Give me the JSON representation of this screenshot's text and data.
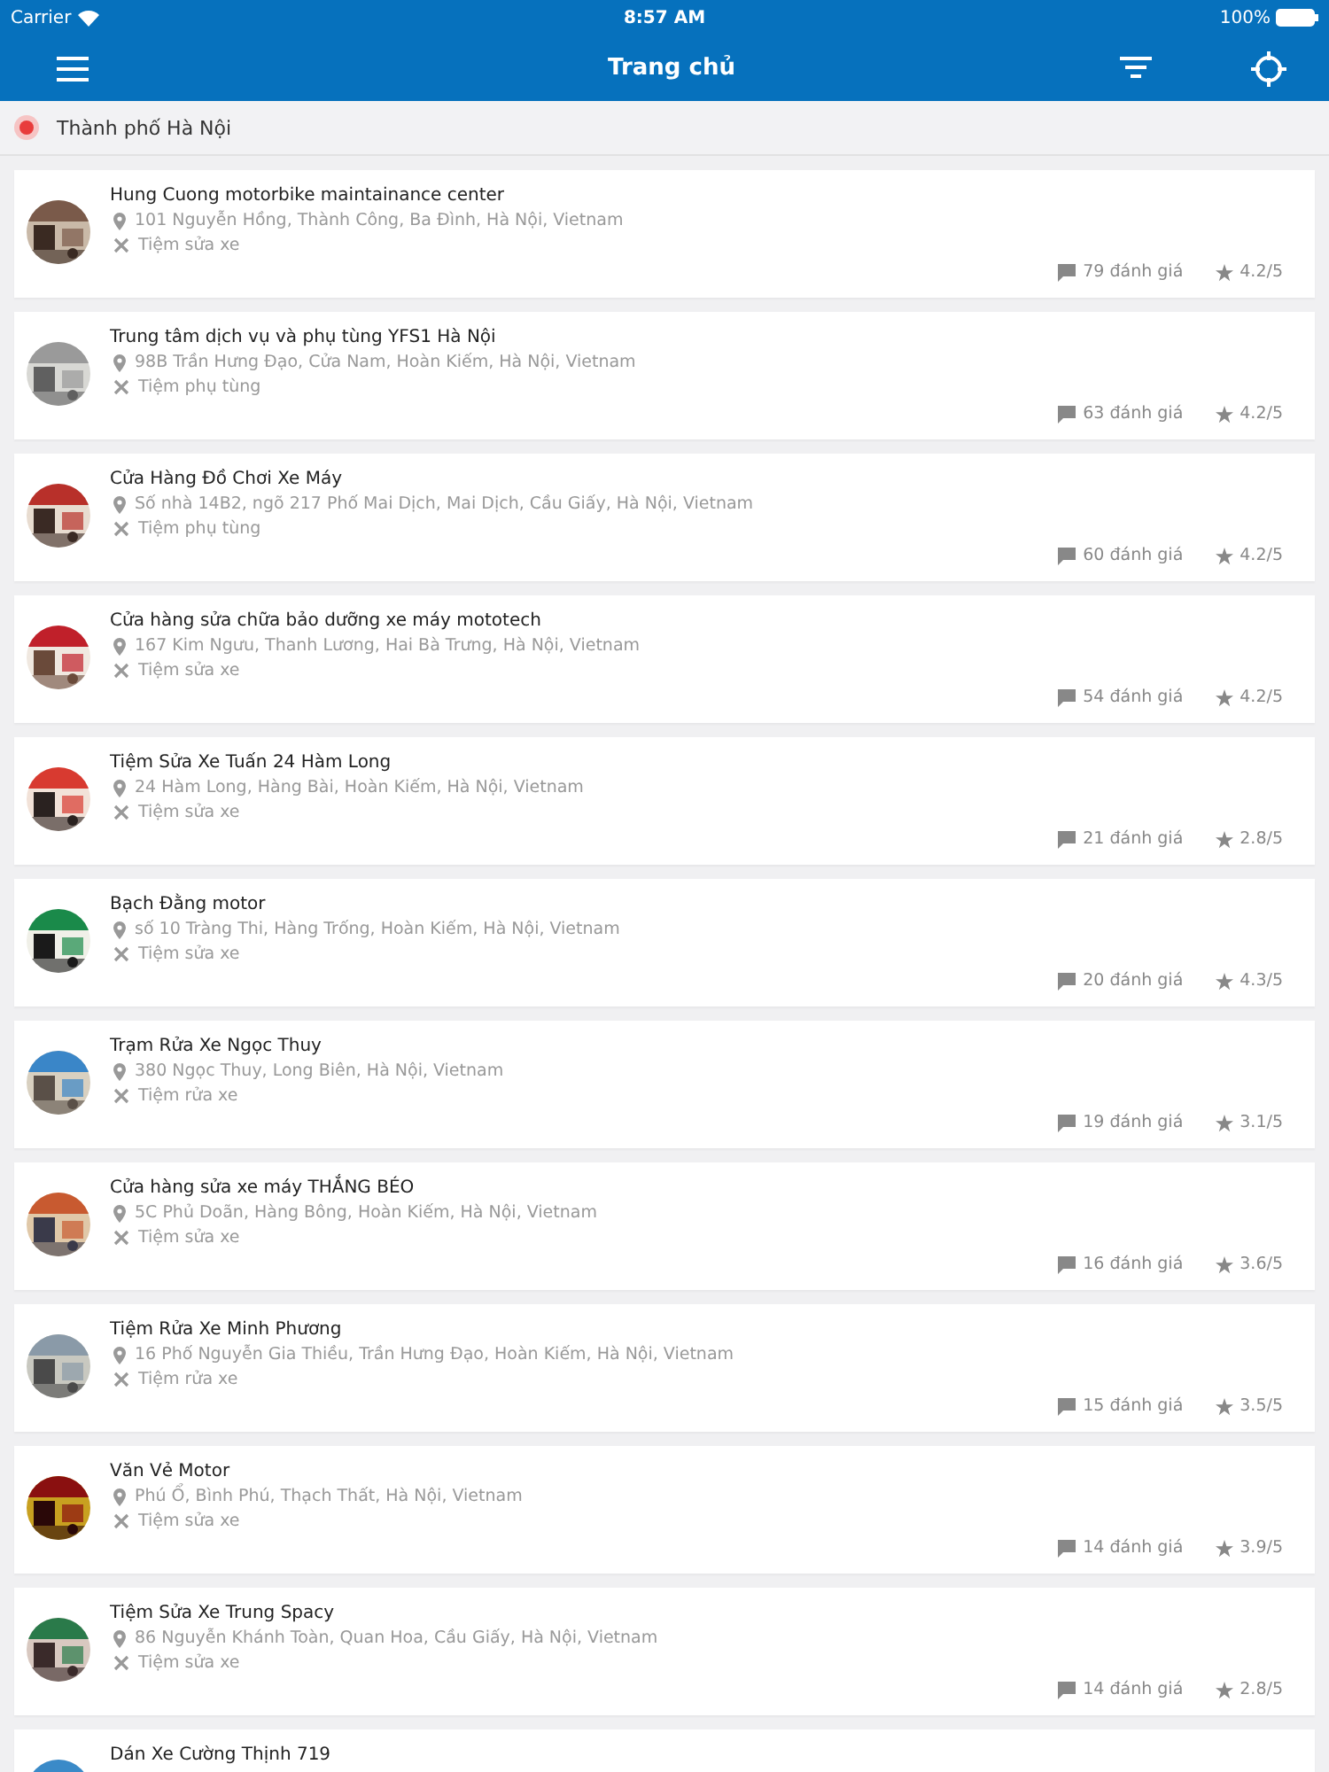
{
  "status_bar": {
    "carrier": "Carrier",
    "time": "8:57 AM",
    "battery": "100%"
  },
  "nav_bar": {
    "title": "Trang chủ"
  },
  "location": {
    "city": "Thành phố Hà Nội"
  },
  "shops": [
    {
      "name": "Hung Cuong motorbike maintainance center",
      "address": "101 Nguyễn Hồng, Thành Công, Ba Đình, Hà Nội, Vietnam",
      "category": "Tiệm sửa xe",
      "reviews": "79 đánh giá",
      "rating": "4.2/5"
    },
    {
      "name": "Trung tâm dịch vụ và phụ tùng YFS1 Hà Nội",
      "address": "98B Trần Hưng Đạo, Cửa Nam, Hoàn Kiếm, Hà Nội, Vietnam",
      "category": "Tiệm phụ tùng",
      "reviews": "63 đánh giá",
      "rating": "4.2/5"
    },
    {
      "name": "Cửa Hàng Đồ Chơi Xe Máy",
      "address": "Số nhà 14B2, ngõ 217 Phố Mai Dịch, Mai Dịch, Cầu Giấy, Hà Nội, Vietnam",
      "category": "Tiệm phụ tùng",
      "reviews": "60 đánh giá",
      "rating": "4.2/5"
    },
    {
      "name": "Cửa hàng sửa chữa bảo dưỡng xe máy mototech",
      "address": "167 Kim Ngưu, Thanh Lương, Hai Bà Trưng, Hà Nội, Vietnam",
      "category": "Tiệm sửa xe",
      "reviews": "54 đánh giá",
      "rating": "4.2/5"
    },
    {
      "name": "Tiệm Sửa Xe Tuấn 24 Hàm Long",
      "address": "24 Hàm Long, Hàng Bài, Hoàn Kiếm, Hà Nội, Vietnam",
      "category": "Tiệm sửa xe",
      "reviews": "21 đánh giá",
      "rating": "2.8/5"
    },
    {
      "name": "Bạch Đằng motor",
      "address": "số 10 Tràng Thi, Hàng Trống, Hoàn Kiếm, Hà Nội, Vietnam",
      "category": "Tiệm sửa xe",
      "reviews": "20 đánh giá",
      "rating": "4.3/5"
    },
    {
      "name": "Trạm Rửa Xe Ngọc Thuy",
      "address": "380 Ngọc Thuy, Long Biên, Hà Nội, Vietnam",
      "category": "Tiệm rửa xe",
      "reviews": "19 đánh giá",
      "rating": "3.1/5"
    },
    {
      "name": "Cửa hàng sửa xe máy THẮNG BÉO",
      "address": "5C Phủ Doãn, Hàng Bông, Hoàn Kiếm, Hà Nội, Vietnam",
      "category": "Tiệm sửa xe",
      "reviews": "16 đánh giá",
      "rating": "3.6/5"
    },
    {
      "name": "Tiệm Rửa Xe Minh Phương",
      "address": "16 Phố Nguyễn Gia Thiều, Trần Hưng Đạo, Hoàn Kiếm, Hà Nội, Vietnam",
      "category": "Tiệm rửa xe",
      "reviews": "15 đánh giá",
      "rating": "3.5/5"
    },
    {
      "name": "Văn Vẻ Motor",
      "address": "Phú Ổ, Bình Phú, Thạch Thất, Hà Nội, Vietnam",
      "category": "Tiệm sửa xe",
      "reviews": "14 đánh giá",
      "rating": "3.9/5"
    },
    {
      "name": "Tiệm Sửa Xe Trung Spacy",
      "address": "86 Nguyễn Khánh Toàn, Quan Hoa, Cầu Giấy, Hà Nội, Vietnam",
      "category": "Tiệm sửa xe",
      "reviews": "14 đánh giá",
      "rating": "2.8/5"
    },
    {
      "name": "Dán Xe Cường Thịnh 719"
    }
  ]
}
